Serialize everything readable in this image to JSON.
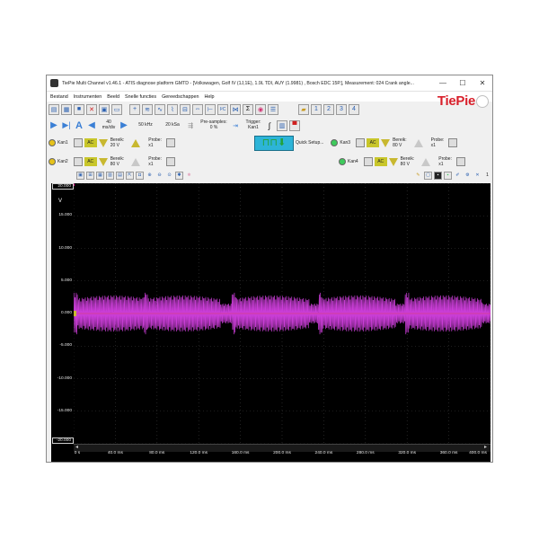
{
  "window": {
    "title": "TiePie Multi Channel v1.46.1 - ATIS diagnose platform GMTD - [Volkswagen, Golf IV (1J,1E), 1.9L TDI, AUY (1.9981) , Bosch EDC 15P.], Measurement: 024 Crank angle...",
    "min": "—",
    "max": "☐",
    "close": "✕"
  },
  "menu": [
    "Bestand",
    "Instrumenten",
    "Beeld",
    "Snelle functies",
    "Gereedschappen",
    "Help"
  ],
  "logo": "TiePie",
  "timebase": {
    "value": "40",
    "unit": "ms/div"
  },
  "sample_rate": "50 kHz",
  "record_length": "20 kSa",
  "pre_samples": {
    "label": "Pre-samples:",
    "value": "0 %"
  },
  "trigger": {
    "label": "Trigger:",
    "value": "Kan1"
  },
  "quick_setup": "Quick Setup...",
  "channels": [
    {
      "name": "Kan1",
      "range_label": "Bereik:",
      "range": "20 V",
      "probe_label": "Probe:",
      "probe": "x1",
      "color": "#e6c21a"
    },
    {
      "name": "Kan2",
      "range_label": "Bereik:",
      "range": "80 V",
      "probe_label": "Probe:",
      "probe": "x1",
      "color": "#e6c21a"
    },
    {
      "name": "Kan3",
      "range_label": "Bereik:",
      "range": "80 V",
      "probe_label": "Probe:",
      "probe": "x1",
      "color": "#3ecb5c"
    },
    {
      "name": "Kan4",
      "range_label": "Bereik:",
      "range": "80 V",
      "probe_label": "Probe:",
      "probe": "x1",
      "color": "#3ecb5c"
    }
  ],
  "ac_label": "AC",
  "colors": {
    "trace": "#c93dd6",
    "grid": "#3a3a3a",
    "trigger_marker": "#c8b830"
  },
  "chart_data": {
    "type": "line",
    "xlabel": "",
    "ylabel": "V",
    "ylim": [
      -20,
      20
    ],
    "xlim": [
      0,
      400
    ],
    "yticks": [
      "20.000",
      "15.000",
      "10.000",
      "5.000",
      "0.000",
      "-5.000",
      "-10.000",
      "-15.000",
      "-20.000"
    ],
    "xticks": [
      "0 s",
      "40.0 ms",
      "80.0 ms",
      "120.0 ms",
      "160.0 ms",
      "200.0 ms",
      "240.0 ms",
      "280.0 ms",
      "320.0 ms",
      "360.0 ms",
      "400.0 ms"
    ],
    "series": [
      {
        "amplitude_v": 2.8,
        "offset_v": 0.0,
        "burst_starts_ms": [
          0,
          67,
          152,
          235,
          318
        ],
        "burst_length_ms": 74
      }
    ]
  }
}
